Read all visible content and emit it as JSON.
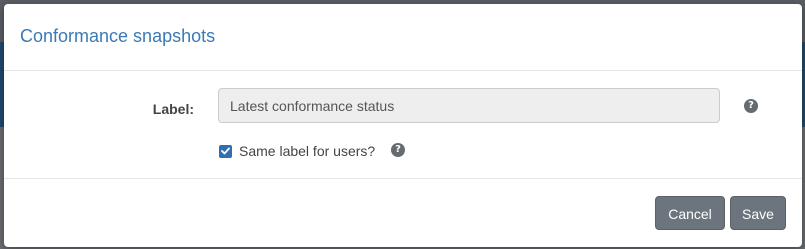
{
  "dialog": {
    "title": "Conformance snapshots"
  },
  "form": {
    "label_caption": "Label:",
    "label_value": "Latest conformance status",
    "same_label_text": "Same label for users?",
    "same_label_checked": true,
    "help_glyph": "?"
  },
  "footer": {
    "cancel_label": "Cancel",
    "save_label": "Save"
  },
  "colors": {
    "title": "#3a7ab5",
    "checkbox": "#2f6fb3",
    "button": "#6c757d",
    "help_icon": "#666b70"
  },
  "icons": {
    "help": "question-circle-icon",
    "check": "checkmark-icon"
  }
}
